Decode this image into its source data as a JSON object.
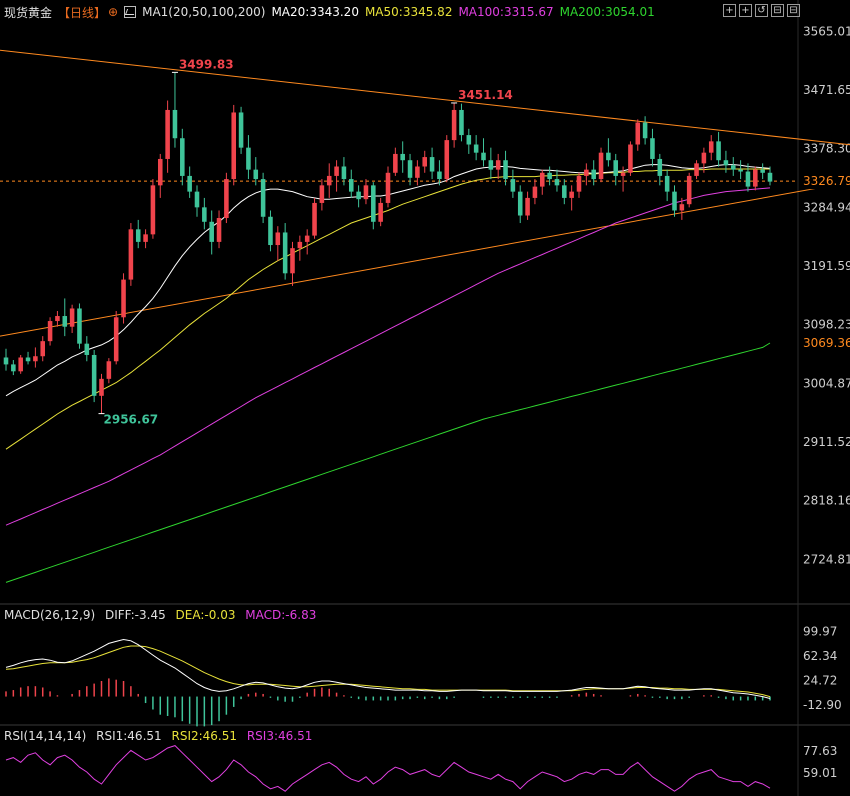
{
  "header": {
    "symbol": "现货黄金",
    "period": "【日线】",
    "ma_params": "MA1(20,50,100,200)",
    "ma20": "MA20:3343.20",
    "ma50": "MA50:3345.82",
    "ma100": "MA100:3315.67",
    "ma200": "MA200:3054.01"
  },
  "toolbar": {
    "b1": "+",
    "b2": "+",
    "b3": "↺",
    "b4": "⊟",
    "b5": "⊟"
  },
  "macd_header": {
    "params": "MACD(26,12,9)",
    "diff": "DIFF:-3.45",
    "dea": "DEA:-0.03",
    "macd": "MACD:-6.83"
  },
  "rsi_header": {
    "params": "RSI(14,14,14)",
    "rsi1": "RSI1:46.51",
    "rsi2": "RSI2:46.51",
    "rsi3": "RSI3:46.51"
  },
  "colors": {
    "up": "#f0444c",
    "down": "#3fc49a",
    "ma20": "#ffffff",
    "ma50": "#e8e23a",
    "ma100": "#e040e0",
    "ma200": "#2fd52f",
    "trend": "#ff8a1f",
    "axis": "#cfcfcf"
  },
  "chart_data": {
    "type": "candlestick",
    "price_axis_ticks": [
      "3565.01",
      "3471.65",
      "3378.30",
      "3284.94",
      "3191.59",
      "3098.23",
      "3004.87",
      "2911.52",
      "2818.16",
      "2724.81"
    ],
    "last_price": "3326.79",
    "ma200_last": "3069.36",
    "ylim": [
      2660,
      3580
    ],
    "annotations": {
      "high1": "3499.83",
      "high2": "3451.14",
      "low": "2956.67"
    },
    "ohlc": [
      [
        3046,
        3060,
        3025,
        3035
      ],
      [
        3035,
        3042,
        3018,
        3024
      ],
      [
        3024,
        3050,
        3020,
        3046
      ],
      [
        3046,
        3055,
        3035,
        3040
      ],
      [
        3040,
        3062,
        3030,
        3048
      ],
      [
        3048,
        3080,
        3040,
        3072
      ],
      [
        3072,
        3110,
        3065,
        3104
      ],
      [
        3104,
        3120,
        3095,
        3112
      ],
      [
        3112,
        3140,
        3080,
        3095
      ],
      [
        3095,
        3130,
        3085,
        3124
      ],
      [
        3124,
        3132,
        3060,
        3068
      ],
      [
        3068,
        3080,
        3040,
        3050
      ],
      [
        3050,
        3058,
        2975,
        2985
      ],
      [
        2985,
        3020,
        2956,
        3012
      ],
      [
        3012,
        3045,
        3005,
        3040
      ],
      [
        3040,
        3120,
        3035,
        3110
      ],
      [
        3110,
        3180,
        3100,
        3170
      ],
      [
        3170,
        3260,
        3160,
        3250
      ],
      [
        3250,
        3265,
        3220,
        3230
      ],
      [
        3230,
        3250,
        3220,
        3242
      ],
      [
        3242,
        3330,
        3235,
        3320
      ],
      [
        3320,
        3370,
        3300,
        3362
      ],
      [
        3362,
        3455,
        3340,
        3440
      ],
      [
        3440,
        3499,
        3380,
        3395
      ],
      [
        3395,
        3410,
        3320,
        3335
      ],
      [
        3335,
        3350,
        3300,
        3310
      ],
      [
        3310,
        3320,
        3270,
        3285
      ],
      [
        3285,
        3300,
        3250,
        3262
      ],
      [
        3262,
        3280,
        3210,
        3230
      ],
      [
        3230,
        3280,
        3220,
        3268
      ],
      [
        3268,
        3340,
        3260,
        3330
      ],
      [
        3330,
        3448,
        3320,
        3436
      ],
      [
        3436,
        3445,
        3370,
        3380
      ],
      [
        3380,
        3400,
        3330,
        3345
      ],
      [
        3345,
        3365,
        3320,
        3330
      ],
      [
        3330,
        3340,
        3260,
        3270
      ],
      [
        3270,
        3280,
        3215,
        3225
      ],
      [
        3225,
        3255,
        3200,
        3245
      ],
      [
        3245,
        3260,
        3170,
        3180
      ],
      [
        3180,
        3230,
        3160,
        3220
      ],
      [
        3220,
        3240,
        3200,
        3230
      ],
      [
        3230,
        3250,
        3210,
        3240
      ],
      [
        3240,
        3300,
        3235,
        3292
      ],
      [
        3292,
        3330,
        3280,
        3320
      ],
      [
        3320,
        3355,
        3300,
        3335
      ],
      [
        3335,
        3360,
        3310,
        3350
      ],
      [
        3350,
        3365,
        3320,
        3330
      ],
      [
        3330,
        3345,
        3300,
        3310
      ],
      [
        3310,
        3320,
        3285,
        3298
      ],
      [
        3298,
        3330,
        3290,
        3320
      ],
      [
        3320,
        3325,
        3250,
        3262
      ],
      [
        3262,
        3300,
        3255,
        3292
      ],
      [
        3292,
        3350,
        3285,
        3340
      ],
      [
        3340,
        3380,
        3335,
        3370
      ],
      [
        3370,
        3390,
        3340,
        3360
      ],
      [
        3360,
        3370,
        3320,
        3332
      ],
      [
        3332,
        3360,
        3320,
        3350
      ],
      [
        3350,
        3375,
        3340,
        3365
      ],
      [
        3365,
        3380,
        3330,
        3342
      ],
      [
        3342,
        3360,
        3320,
        3330
      ],
      [
        3330,
        3400,
        3325,
        3392
      ],
      [
        3392,
        3451,
        3380,
        3440
      ],
      [
        3440,
        3450,
        3390,
        3400
      ],
      [
        3400,
        3410,
        3370,
        3385
      ],
      [
        3385,
        3400,
        3360,
        3372
      ],
      [
        3372,
        3395,
        3350,
        3360
      ],
      [
        3360,
        3380,
        3330,
        3345
      ],
      [
        3345,
        3370,
        3330,
        3360
      ],
      [
        3360,
        3375,
        3320,
        3330
      ],
      [
        3330,
        3345,
        3300,
        3310
      ],
      [
        3310,
        3320,
        3260,
        3272
      ],
      [
        3272,
        3310,
        3265,
        3300
      ],
      [
        3300,
        3330,
        3290,
        3318
      ],
      [
        3318,
        3345,
        3305,
        3340
      ],
      [
        3340,
        3350,
        3320,
        3330
      ],
      [
        3330,
        3345,
        3310,
        3320
      ],
      [
        3320,
        3330,
        3290,
        3300
      ],
      [
        3300,
        3320,
        3280,
        3310
      ],
      [
        3310,
        3340,
        3300,
        3335
      ],
      [
        3335,
        3355,
        3320,
        3345
      ],
      [
        3345,
        3360,
        3320,
        3330
      ],
      [
        3330,
        3380,
        3325,
        3372
      ],
      [
        3372,
        3395,
        3350,
        3360
      ],
      [
        3360,
        3370,
        3320,
        3335
      ],
      [
        3335,
        3350,
        3310,
        3340
      ],
      [
        3340,
        3390,
        3335,
        3385
      ],
      [
        3385,
        3425,
        3375,
        3420
      ],
      [
        3420,
        3430,
        3385,
        3395
      ],
      [
        3395,
        3410,
        3350,
        3362
      ],
      [
        3362,
        3370,
        3320,
        3335
      ],
      [
        3335,
        3345,
        3295,
        3310
      ],
      [
        3310,
        3320,
        3270,
        3280
      ],
      [
        3280,
        3300,
        3265,
        3290
      ],
      [
        3290,
        3340,
        3285,
        3335
      ],
      [
        3335,
        3360,
        3330,
        3355
      ],
      [
        3355,
        3380,
        3340,
        3372
      ],
      [
        3372,
        3400,
        3360,
        3390
      ],
      [
        3390,
        3405,
        3350,
        3360
      ],
      [
        3360,
        3375,
        3340,
        3352
      ],
      [
        3352,
        3365,
        3335,
        3345
      ],
      [
        3345,
        3360,
        3330,
        3342
      ],
      [
        3342,
        3355,
        3310,
        3318
      ],
      [
        3318,
        3350,
        3312,
        3345
      ],
      [
        3345,
        3355,
        3330,
        3340
      ],
      [
        3340,
        3350,
        3320,
        3326
      ]
    ],
    "ma20": [
      2985,
      2992,
      2998,
      3004,
      3010,
      3018,
      3026,
      3034,
      3040,
      3047,
      3052,
      3058,
      3062,
      3066,
      3072,
      3080,
      3090,
      3102,
      3115,
      3127,
      3140,
      3156,
      3174,
      3192,
      3208,
      3222,
      3234,
      3245,
      3254,
      3262,
      3272,
      3284,
      3294,
      3302,
      3308,
      3312,
      3314,
      3314,
      3312,
      3310,
      3306,
      3302,
      3300,
      3298,
      3298,
      3299,
      3300,
      3301,
      3302,
      3302,
      3303,
      3303,
      3305,
      3308,
      3311,
      3314,
      3317,
      3320,
      3322,
      3324,
      3328,
      3334,
      3338,
      3342,
      3346,
      3348,
      3349,
      3350,
      3350,
      3349,
      3347,
      3346,
      3345,
      3344,
      3344,
      3343,
      3342,
      3341,
      3340,
      3340,
      3339,
      3340,
      3341,
      3342,
      3343,
      3346,
      3349,
      3352,
      3353,
      3353,
      3352,
      3350,
      3348,
      3347,
      3347,
      3348,
      3350,
      3352,
      3353,
      3353,
      3352,
      3350,
      3349,
      3348,
      3347
    ],
    "ma50": [
      2900,
      2908,
      2916,
      2924,
      2932,
      2940,
      2948,
      2956,
      2963,
      2970,
      2976,
      2982,
      2988,
      2994,
      3000,
      3006,
      3014,
      3022,
      3031,
      3040,
      3049,
      3058,
      3068,
      3078,
      3088,
      3098,
      3107,
      3116,
      3124,
      3132,
      3140,
      3150,
      3160,
      3170,
      3178,
      3186,
      3193,
      3200,
      3206,
      3212,
      3218,
      3224,
      3230,
      3236,
      3242,
      3248,
      3254,
      3260,
      3264,
      3268,
      3272,
      3276,
      3280,
      3285,
      3290,
      3294,
      3298,
      3302,
      3306,
      3310,
      3314,
      3318,
      3322,
      3325,
      3328,
      3330,
      3332,
      3333,
      3334,
      3334,
      3334,
      3334,
      3334,
      3335,
      3335,
      3336,
      3336,
      3337,
      3337,
      3338,
      3338,
      3339,
      3340,
      3340,
      3341,
      3342,
      3342,
      3343,
      3343,
      3344,
      3344,
      3344,
      3344,
      3345,
      3345,
      3345,
      3346,
      3346,
      3346,
      3346,
      3346,
      3346,
      3346,
      3346,
      3346
    ],
    "ma100": [
      2779,
      2784,
      2789,
      2794,
      2799,
      2804,
      2809,
      2814,
      2819,
      2824,
      2829,
      2834,
      2839,
      2844,
      2849,
      2855,
      2861,
      2867,
      2873,
      2879,
      2885,
      2891,
      2898,
      2905,
      2912,
      2919,
      2926,
      2933,
      2940,
      2947,
      2954,
      2961,
      2968,
      2975,
      2982,
      2988,
      2994,
      3000,
      3006,
      3012,
      3018,
      3024,
      3030,
      3036,
      3042,
      3048,
      3054,
      3060,
      3066,
      3072,
      3078,
      3084,
      3090,
      3096,
      3102,
      3108,
      3114,
      3120,
      3126,
      3132,
      3138,
      3144,
      3150,
      3156,
      3162,
      3168,
      3174,
      3180,
      3185,
      3190,
      3195,
      3200,
      3205,
      3210,
      3215,
      3220,
      3225,
      3230,
      3235,
      3240,
      3245,
      3250,
      3255,
      3260,
      3264,
      3268,
      3272,
      3276,
      3280,
      3284,
      3288,
      3292,
      3295,
      3298,
      3301,
      3304,
      3306,
      3308,
      3310,
      3311,
      3312,
      3313,
      3314,
      3315,
      3316
    ],
    "ma200": [
      2688,
      2692,
      2696,
      2700,
      2704,
      2708,
      2712,
      2716,
      2720,
      2724,
      2728,
      2732,
      2736,
      2740,
      2744,
      2748,
      2752,
      2756,
      2760,
      2764,
      2768,
      2772,
      2776,
      2780,
      2784,
      2788,
      2792,
      2796,
      2800,
      2804,
      2808,
      2812,
      2816,
      2820,
      2824,
      2828,
      2832,
      2836,
      2840,
      2844,
      2848,
      2852,
      2856,
      2860,
      2864,
      2868,
      2872,
      2876,
      2880,
      2884,
      2888,
      2892,
      2896,
      2900,
      2904,
      2908,
      2912,
      2916,
      2920,
      2924,
      2928,
      2932,
      2936,
      2940,
      2944,
      2948,
      2951,
      2954,
      2957,
      2960,
      2963,
      2966,
      2969,
      2972,
      2975,
      2978,
      2981,
      2984,
      2987,
      2990,
      2993,
      2996,
      2999,
      3002,
      3005,
      3008,
      3011,
      3014,
      3017,
      3020,
      3023,
      3026,
      3029,
      3032,
      3035,
      3038,
      3041,
      3044,
      3047,
      3050,
      3053,
      3056,
      3059,
      3062,
      3069
    ],
    "trendlines": [
      {
        "name": "resistance",
        "from": [
          0,
          3535
        ],
        "to": [
          115,
          3381
        ]
      },
      {
        "name": "support",
        "from": [
          0,
          3080
        ],
        "to": [
          115,
          3331
        ]
      }
    ],
    "macd": {
      "axis_ticks": [
        "99.97",
        "62.34",
        "24.72",
        "-12.90"
      ],
      "ylim": [
        -30,
        115
      ],
      "diff": [
        45,
        48,
        52,
        55,
        57,
        58,
        56,
        53,
        52,
        55,
        60,
        65,
        70,
        76,
        82,
        85,
        88,
        86,
        80,
        72,
        64,
        56,
        50,
        44,
        36,
        28,
        20,
        14,
        10,
        8,
        9,
        12,
        16,
        20,
        22,
        21,
        18,
        15,
        13,
        12,
        14,
        18,
        22,
        24,
        24,
        22,
        20,
        18,
        16,
        14,
        13,
        12,
        11,
        10,
        10,
        10,
        10,
        9,
        9,
        8,
        8,
        9,
        10,
        10,
        10,
        9,
        9,
        9,
        9,
        8,
        8,
        8,
        8,
        8,
        8,
        8,
        9,
        10,
        12,
        14,
        14,
        13,
        12,
        12,
        12,
        14,
        16,
        15,
        13,
        12,
        11,
        10,
        10,
        10,
        11,
        12,
        12,
        10,
        8,
        6,
        5,
        4,
        2,
        0,
        -3
      ],
      "dea": [
        42,
        43,
        45,
        47,
        49,
        51,
        52,
        52,
        52,
        53,
        55,
        57,
        60,
        64,
        68,
        72,
        76,
        78,
        78,
        77,
        74,
        70,
        65,
        60,
        55,
        49,
        43,
        37,
        32,
        27,
        23,
        20,
        18,
        18,
        19,
        19,
        19,
        18,
        17,
        16,
        15,
        15,
        16,
        17,
        18,
        19,
        19,
        19,
        18,
        17,
        16,
        15,
        14,
        13,
        12,
        12,
        11,
        11,
        10,
        10,
        10,
        10,
        10,
        10,
        10,
        10,
        10,
        10,
        10,
        9,
        9,
        9,
        9,
        9,
        9,
        9,
        9,
        9,
        10,
        11,
        12,
        12,
        12,
        12,
        12,
        13,
        14,
        14,
        14,
        13,
        13,
        12,
        12,
        11,
        11,
        11,
        11,
        11,
        10,
        9,
        8,
        7,
        5,
        3,
        0
      ],
      "hist": [
        8,
        10,
        14,
        16,
        16,
        14,
        8,
        2,
        0,
        4,
        10,
        16,
        20,
        24,
        28,
        26,
        24,
        16,
        4,
        -10,
        -20,
        -28,
        -30,
        -32,
        -38,
        -42,
        -46,
        -46,
        -44,
        -38,
        -28,
        -16,
        -4,
        4,
        6,
        4,
        -2,
        -6,
        -8,
        -8,
        -2,
        6,
        12,
        14,
        12,
        6,
        2,
        -2,
        -4,
        -6,
        -6,
        -6,
        -6,
        -6,
        -4,
        -4,
        -2,
        -4,
        -2,
        -4,
        -4,
        -2,
        0,
        0,
        0,
        -2,
        -2,
        -2,
        -2,
        -2,
        -2,
        -2,
        -2,
        -2,
        -2,
        -2,
        0,
        2,
        4,
        6,
        4,
        2,
        0,
        0,
        0,
        2,
        4,
        2,
        -2,
        -2,
        -4,
        -4,
        -4,
        -2,
        0,
        2,
        2,
        -2,
        -4,
        -6,
        -6,
        -6,
        -6,
        -6,
        -6
      ]
    },
    "rsi": {
      "axis_ticks": [
        "77.63",
        "59.01"
      ],
      "ylim": [
        40,
        85
      ],
      "rsi1": [
        70,
        72,
        68,
        74,
        76,
        70,
        66,
        72,
        74,
        70,
        64,
        60,
        54,
        50,
        58,
        66,
        72,
        78,
        74,
        70,
        72,
        76,
        80,
        82,
        76,
        70,
        64,
        58,
        52,
        56,
        62,
        70,
        66,
        60,
        56,
        50,
        46,
        48,
        44,
        50,
        54,
        58,
        62,
        66,
        68,
        64,
        58,
        54,
        52,
        56,
        50,
        54,
        60,
        64,
        62,
        58,
        60,
        62,
        58,
        56,
        62,
        68,
        64,
        60,
        58,
        56,
        54,
        58,
        54,
        52,
        46,
        52,
        56,
        60,
        58,
        56,
        52,
        54,
        58,
        60,
        58,
        62,
        62,
        58,
        58,
        64,
        68,
        62,
        56,
        52,
        48,
        44,
        48,
        54,
        58,
        60,
        62,
        56,
        54,
        52,
        52,
        48,
        52,
        50,
        46.5
      ]
    }
  }
}
